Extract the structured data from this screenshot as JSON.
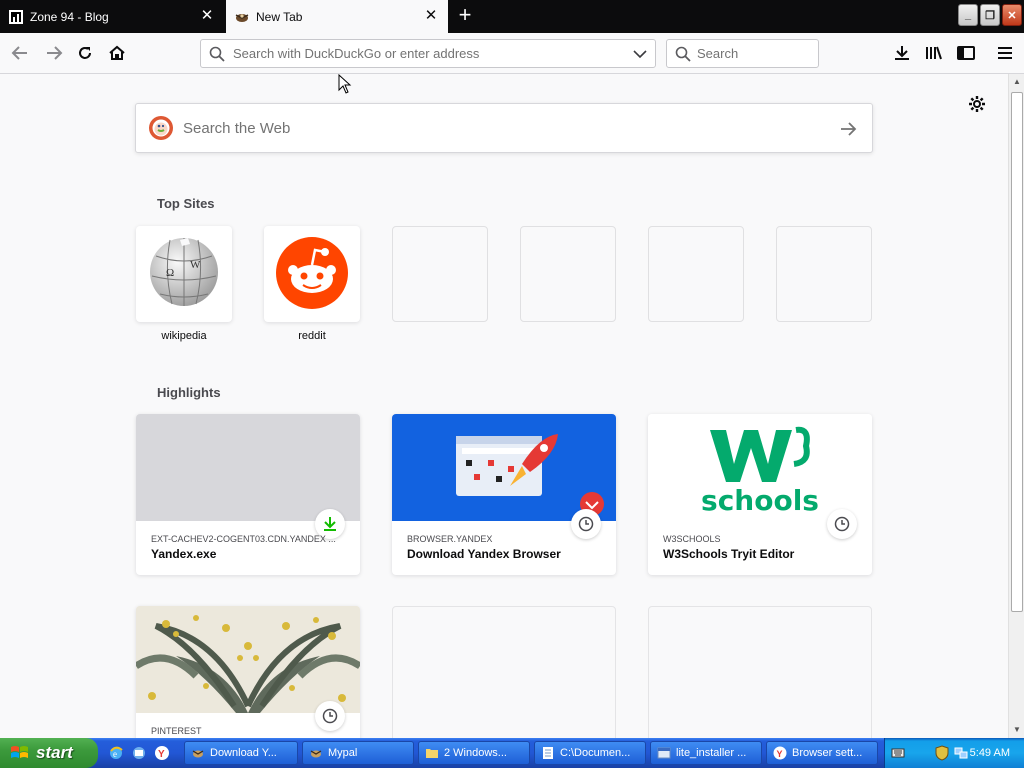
{
  "tabs": [
    {
      "title": "Zone 94 - Blog",
      "active": false
    },
    {
      "title": "New Tab",
      "active": true
    }
  ],
  "toolbar": {
    "url_placeholder": "Search with DuckDuckGo or enter address",
    "search_placeholder": "Search"
  },
  "newtab": {
    "websearch_placeholder": "Search the Web",
    "top_sites_heading": "Top Sites",
    "top_sites": [
      {
        "label": "wikipedia",
        "icon": "wikipedia-globe-icon"
      },
      {
        "label": "reddit",
        "icon": "reddit-icon"
      },
      {
        "label": ""
      },
      {
        "label": ""
      },
      {
        "label": ""
      },
      {
        "label": ""
      }
    ],
    "highlights_heading": "Highlights",
    "highlights": [
      {
        "host": "EXT-CACHEV2-COGENT03.CDN.YANDEX ...",
        "title": "Yandex.exe",
        "badge": "download-icon"
      },
      {
        "host": "BROWSER.YANDEX",
        "title": "Download Yandex Browser",
        "badge": "clock-icon"
      },
      {
        "host": "W3SCHOOLS",
        "title": "W3Schools Tryit Editor",
        "badge": "clock-icon",
        "logo_text": "schools"
      },
      {
        "host": "PINTEREST",
        "title": "",
        "badge": "clock-icon"
      }
    ]
  },
  "taskbar": {
    "start_label": "start",
    "items": [
      {
        "label": "Download Y...",
        "active": false
      },
      {
        "label": "Mypal",
        "active": true
      },
      {
        "label": "2 Windows...",
        "active": false
      },
      {
        "label": "C:\\Documen...",
        "active": false
      },
      {
        "label": "lite_installer ...",
        "active": false
      },
      {
        "label": "Browser sett...",
        "active": false
      }
    ],
    "clock": "5:49 AM"
  },
  "colors": {
    "reddit": "#ff4500",
    "yandex_blue": "#1262e0",
    "w3schools_green": "#04aa6d",
    "download_green": "#12bc00"
  }
}
